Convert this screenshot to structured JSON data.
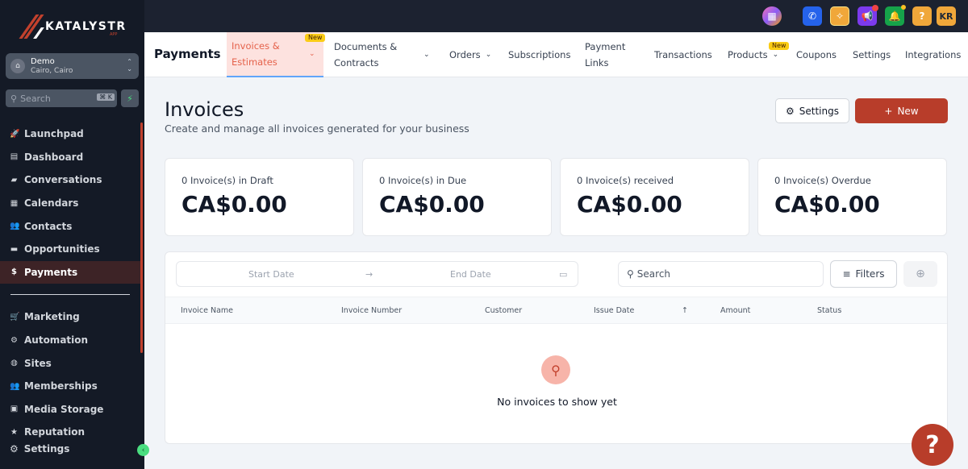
{
  "brand": {
    "name": "KATALYSTR",
    "sub": "APP"
  },
  "location": {
    "name": "Demo",
    "city": "Cairo, Cairo"
  },
  "sidebar_search": {
    "placeholder": "Search",
    "shortcut": "⌘ K"
  },
  "sidebar": {
    "items": [
      {
        "label": "Launchpad",
        "icon": "🚀"
      },
      {
        "label": "Dashboard",
        "icon": "▤"
      },
      {
        "label": "Conversations",
        "icon": "▰"
      },
      {
        "label": "Calendars",
        "icon": "▦"
      },
      {
        "label": "Contacts",
        "icon": "👥"
      },
      {
        "label": "Opportunities",
        "icon": "▬"
      },
      {
        "label": "Payments",
        "icon": "$"
      }
    ],
    "items2": [
      {
        "label": "Marketing",
        "icon": "🛒"
      },
      {
        "label": "Automation",
        "icon": "⚙"
      },
      {
        "label": "Sites",
        "icon": "◍"
      },
      {
        "label": "Memberships",
        "icon": "👥"
      },
      {
        "label": "Media Storage",
        "icon": "▣"
      },
      {
        "label": "Reputation",
        "icon": "★"
      }
    ],
    "settings": "Settings"
  },
  "topbar": {
    "avatar": "KR"
  },
  "tabs": {
    "title": "Payments",
    "new_badge": "New",
    "items": [
      "Invoices & Estimates",
      "Documents & Contracts",
      "Orders",
      "Subscriptions",
      "Payment Links",
      "Transactions",
      "Products",
      "Coupons",
      "Settings",
      "Integrations"
    ]
  },
  "header": {
    "title": "Invoices",
    "subtitle": "Create and manage all invoices generated for your business",
    "settings": "Settings",
    "new": "New"
  },
  "cards": [
    {
      "label": "0 Invoice(s) in Draft",
      "value": "CA$0.00"
    },
    {
      "label": "0 Invoice(s) in Due",
      "value": "CA$0.00"
    },
    {
      "label": "0 Invoice(s) received",
      "value": "CA$0.00"
    },
    {
      "label": "0 Invoice(s) Overdue",
      "value": "CA$0.00"
    }
  ],
  "filters": {
    "start": "Start Date",
    "end": "End Date",
    "search": "Search",
    "filters": "Filters"
  },
  "table": {
    "columns": [
      "Invoice Name",
      "Invoice Number",
      "Customer",
      "Issue Date",
      "Amount",
      "Status"
    ],
    "empty": "No invoices to show yet"
  },
  "colors": {
    "accent": "#b83d2a",
    "sidebar": "#141a26"
  }
}
